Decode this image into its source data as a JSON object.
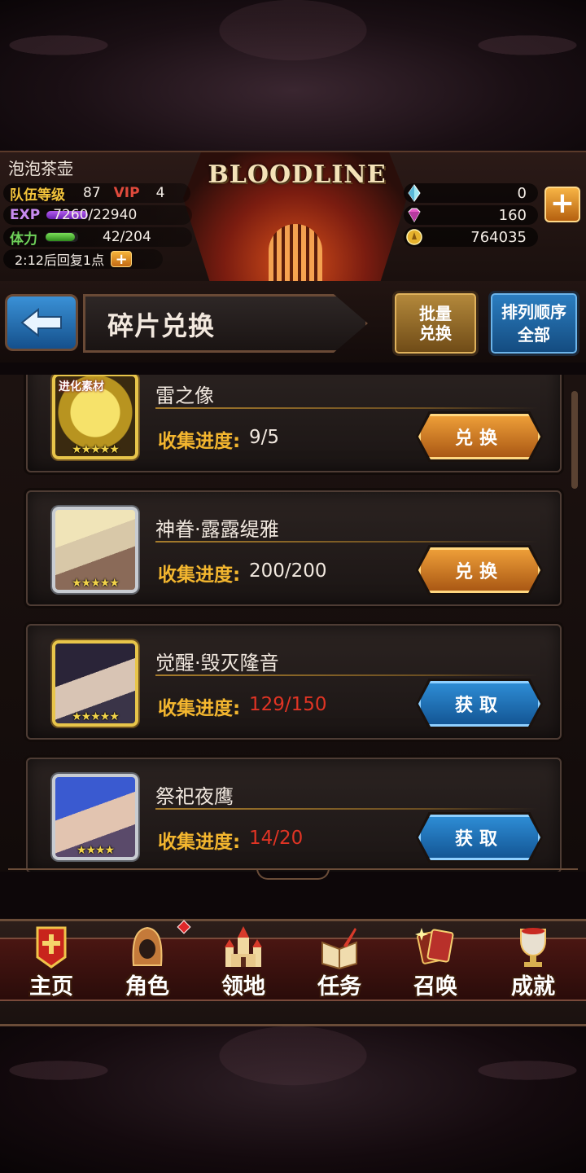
{
  "player": {
    "name": "泡泡茶壶",
    "team_level_label": "队伍等级",
    "team_level": "87",
    "vip_label": "VIP",
    "vip": "4",
    "exp_label": "EXP",
    "exp": "7260/22940",
    "exp_fraction": 0.316,
    "stamina_label": "体力",
    "stamina": "42/204",
    "stamina_fraction": 0.206,
    "recover_text": "2:12后回复1点"
  },
  "logo": "BLOODLINE",
  "currencies": [
    {
      "icon": "crystal-icon",
      "value": "0"
    },
    {
      "icon": "gem-icon",
      "value": "160"
    },
    {
      "icon": "gold-coin-icon",
      "value": "764035"
    }
  ],
  "title_bar": {
    "title": "碎片兑换",
    "batch_line1": "批量",
    "batch_line2": "兑换",
    "sort_line1": "排列顺序",
    "sort_line2": "全部"
  },
  "items": [
    {
      "name": "雷之像",
      "tag": "进化素材",
      "progress_label": "收集进度:",
      "progress": "9/5",
      "stars": "★★★★★",
      "action": "兑换",
      "frame": "gold"
    },
    {
      "name": "神眷·露露缇雅",
      "tag": "",
      "progress_label": "收集进度:",
      "progress": "200/200",
      "stars": "★★★★★",
      "action": "兑换",
      "frame": "silver"
    },
    {
      "name": "觉醒·毁灭隆音",
      "tag": "",
      "progress_label": "收集进度:",
      "progress": "129/150",
      "stars": "★★★★★",
      "action": "获取",
      "frame": "gold"
    },
    {
      "name": "祭祀夜鹰",
      "tag": "",
      "progress_label": "收集进度:",
      "progress": "14/20",
      "stars": "★★★★",
      "action": "获取",
      "frame": "silver"
    }
  ],
  "nav": [
    {
      "label": "主页",
      "icon": "home-banner-icon"
    },
    {
      "label": "角色",
      "icon": "character-hood-icon"
    },
    {
      "label": "领地",
      "icon": "castle-icon"
    },
    {
      "label": "任务",
      "icon": "quest-book-icon"
    },
    {
      "label": "召唤",
      "icon": "summon-cards-icon"
    },
    {
      "label": "成就",
      "icon": "trophy-icon"
    }
  ],
  "colors": {
    "gold": "#f3b62f",
    "red_progress": "#e03424",
    "button_orange": "#f1a23a",
    "button_blue": "#2f8fd8"
  }
}
